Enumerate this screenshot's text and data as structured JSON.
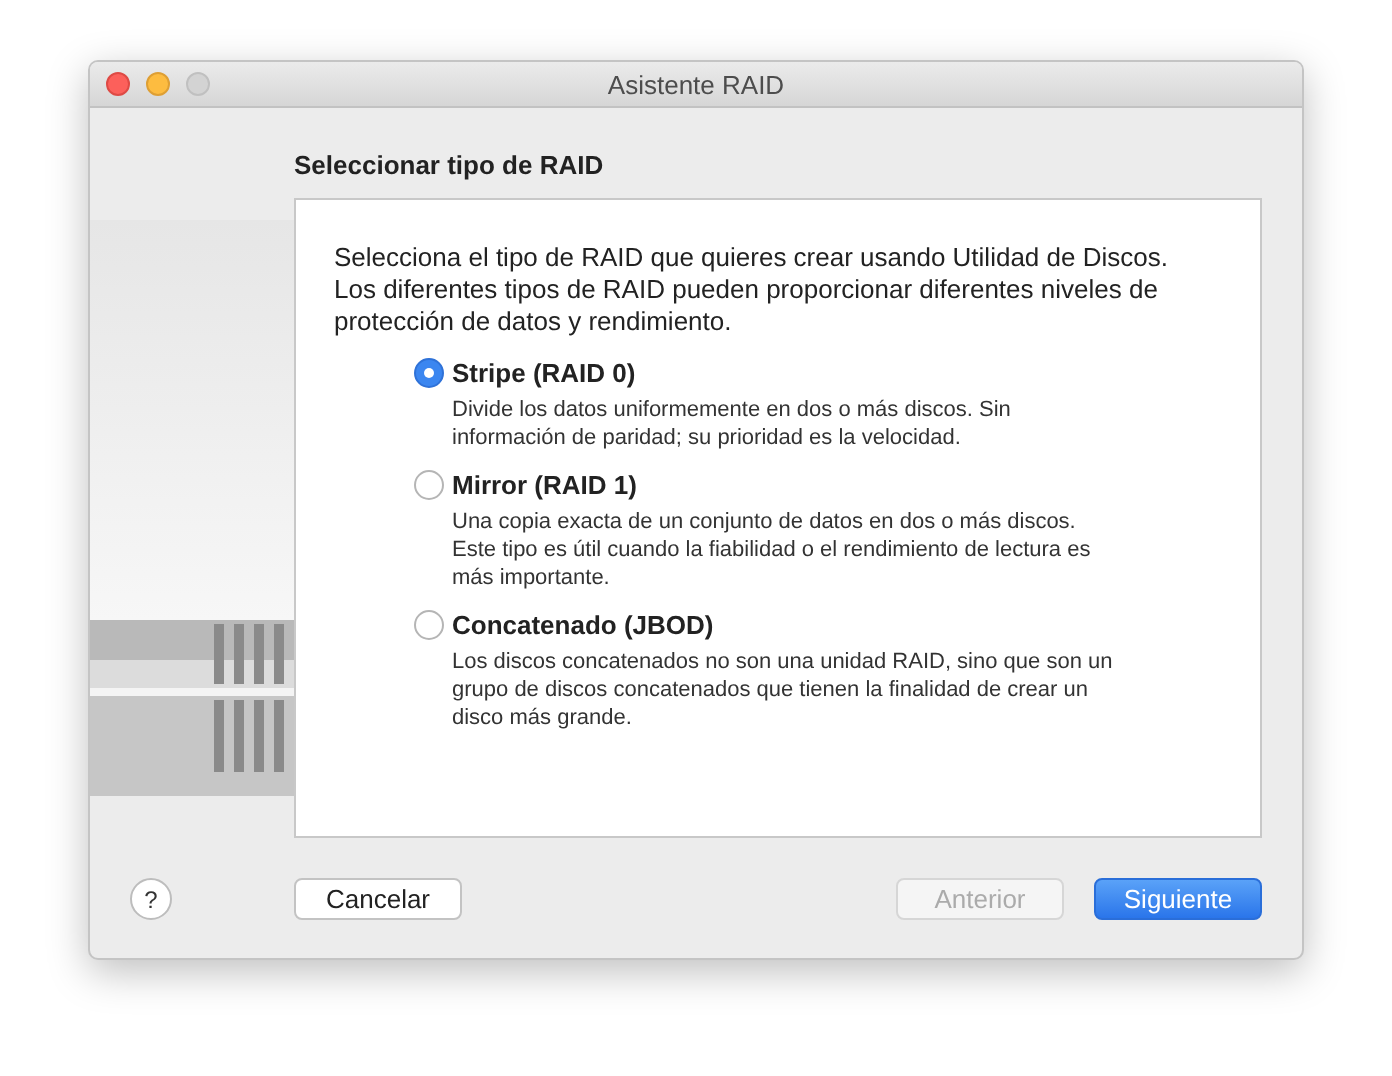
{
  "window": {
    "title": "Asistente RAID"
  },
  "heading": "Seleccionar tipo de RAID",
  "intro": "Selecciona el tipo de RAID que quieres crear usando Utilidad de Discos. Los diferentes tipos de RAID pueden proporcionar diferentes niveles de protección de datos y rendimiento.",
  "options": [
    {
      "label": "Stripe (RAID 0)",
      "description": "Divide los datos uniformemente en dos o más discos. Sin información de paridad; su prioridad es la velocidad.",
      "selected": true
    },
    {
      "label": "Mirror (RAID 1)",
      "description": "Una copia exacta de un conjunto de datos en dos o más discos. Este tipo es útil cuando la fiabilidad o el rendimiento de lectura es más importante.",
      "selected": false
    },
    {
      "label": "Concatenado (JBOD)",
      "description": "Los discos concatenados no son una unidad RAID, sino que son un grupo de discos concatenados que tienen la finalidad de crear un disco más grande.",
      "selected": false
    }
  ],
  "help": {
    "label": "?"
  },
  "buttons": [
    {
      "label": "Cancelar",
      "kind": "left",
      "disabled": false,
      "default": false
    },
    {
      "label": "Anterior",
      "kind": "right",
      "disabled": true,
      "default": false
    },
    {
      "label": "Siguiente",
      "kind": "right",
      "disabled": false,
      "default": true
    }
  ]
}
